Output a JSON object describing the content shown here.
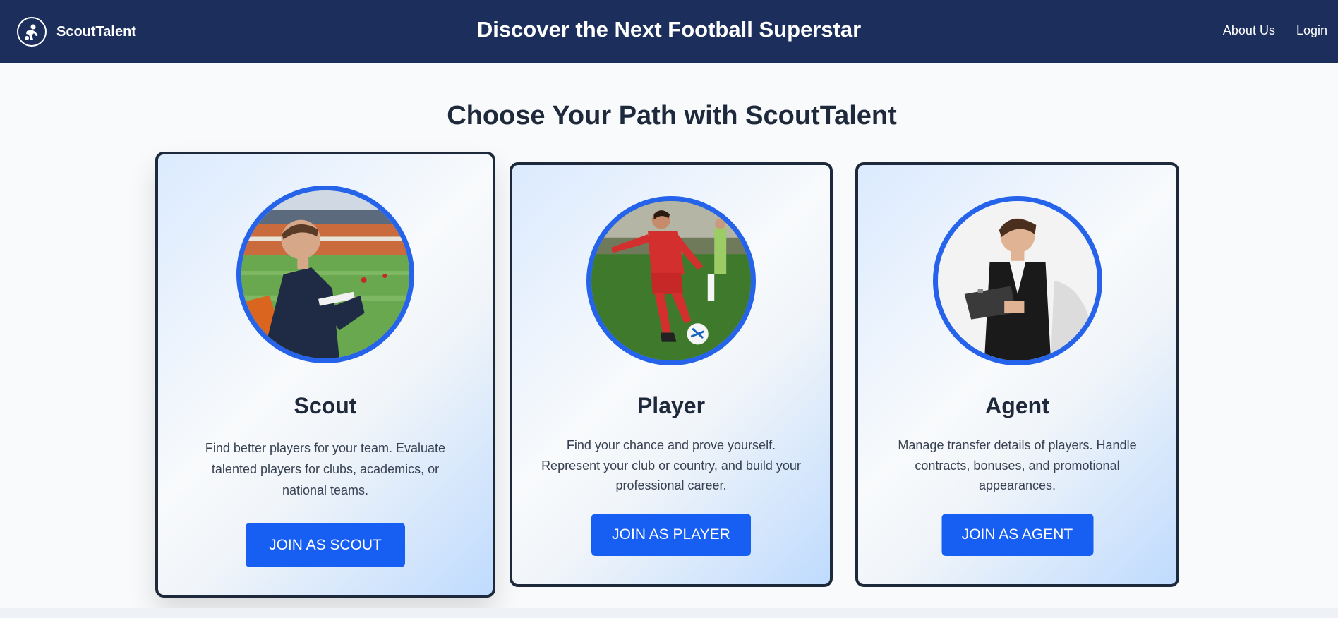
{
  "navbar": {
    "brand": "ScoutTalent",
    "title": "Discover the Next Football Superstar",
    "links": [
      "About Us",
      "Login"
    ]
  },
  "heading": "Choose Your Path with ScoutTalent",
  "cards": [
    {
      "title": "Scout",
      "description": "Find better players for your team. Evaluate talented players for clubs, academics, or national teams.",
      "button": "JOIN AS SCOUT",
      "image": "scout-in-stadium-photo"
    },
    {
      "title": "Player",
      "description": "Find your chance and prove yourself. Represent your club or country, and build your professional career.",
      "button": "JOIN AS PLAYER",
      "image": "footballer-kicking-ball-photo"
    },
    {
      "title": "Agent",
      "description": "Manage transfer details of players. Handle contracts, bonuses, and promotional appearances.",
      "button": "JOIN AS AGENT",
      "image": "agent-with-clipboard-photo"
    }
  ],
  "colors": {
    "navbar": "#1c2f5c",
    "accent": "#175ef2",
    "ring": "#2563eb",
    "text": "#1e293b"
  }
}
